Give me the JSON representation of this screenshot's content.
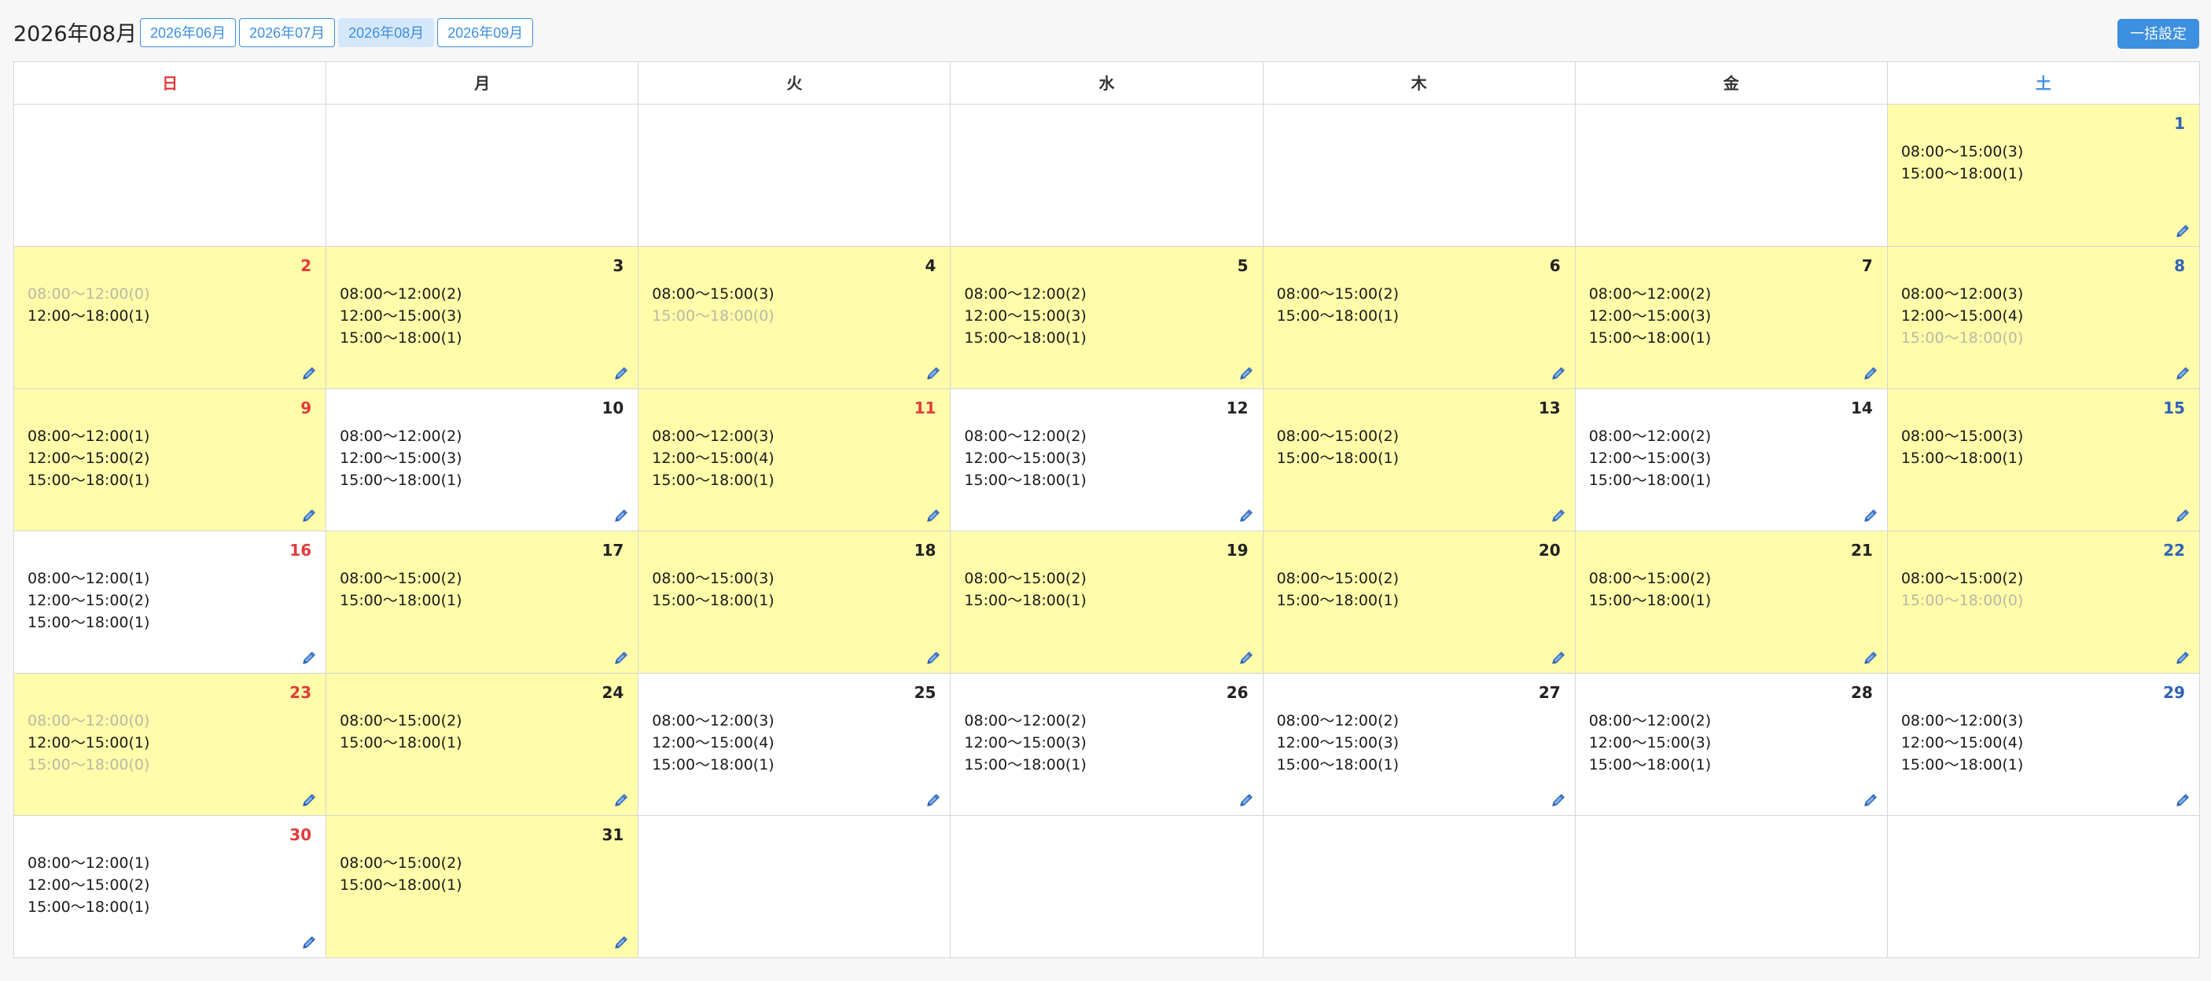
{
  "header": {
    "title": "2026年08月",
    "tabs": [
      {
        "label": "2026年06月",
        "active": false
      },
      {
        "label": "2026年07月",
        "active": false
      },
      {
        "label": "2026年08月",
        "active": true
      },
      {
        "label": "2026年09月",
        "active": false
      }
    ],
    "bulk_button_label": "一括設定"
  },
  "colors": {
    "accent": "#3d8fe0",
    "highlight": "#fffcaa",
    "sunday": "#e23b3b",
    "saturday": "#2f63b8",
    "inactive_text": "#b9b9a6"
  },
  "calendar": {
    "weekdays": [
      "日",
      "月",
      "火",
      "水",
      "木",
      "金",
      "土"
    ],
    "weeks": [
      [
        null,
        null,
        null,
        null,
        null,
        null,
        {
          "day": "1",
          "highlight": true,
          "slots": [
            {
              "text": "08:00〜15:00(3)",
              "active": true
            },
            {
              "text": "15:00〜18:00(1)",
              "active": true
            }
          ]
        }
      ],
      [
        {
          "day": "2",
          "highlight": true,
          "slots": [
            {
              "text": "08:00〜12:00(0)",
              "active": false
            },
            {
              "text": "12:00〜18:00(1)",
              "active": true
            }
          ]
        },
        {
          "day": "3",
          "highlight": true,
          "slots": [
            {
              "text": "08:00〜12:00(2)",
              "active": true
            },
            {
              "text": "12:00〜15:00(3)",
              "active": true
            },
            {
              "text": "15:00〜18:00(1)",
              "active": true
            }
          ]
        },
        {
          "day": "4",
          "highlight": true,
          "slots": [
            {
              "text": "08:00〜15:00(3)",
              "active": true
            },
            {
              "text": "15:00〜18:00(0)",
              "active": false
            }
          ]
        },
        {
          "day": "5",
          "highlight": true,
          "slots": [
            {
              "text": "08:00〜12:00(2)",
              "active": true
            },
            {
              "text": "12:00〜15:00(3)",
              "active": true
            },
            {
              "text": "15:00〜18:00(1)",
              "active": true
            }
          ]
        },
        {
          "day": "6",
          "highlight": true,
          "slots": [
            {
              "text": "08:00〜15:00(2)",
              "active": true
            },
            {
              "text": "15:00〜18:00(1)",
              "active": true
            }
          ]
        },
        {
          "day": "7",
          "highlight": true,
          "slots": [
            {
              "text": "08:00〜12:00(2)",
              "active": true
            },
            {
              "text": "12:00〜15:00(3)",
              "active": true
            },
            {
              "text": "15:00〜18:00(1)",
              "active": true
            }
          ]
        },
        {
          "day": "8",
          "highlight": true,
          "slots": [
            {
              "text": "08:00〜12:00(3)",
              "active": true
            },
            {
              "text": "12:00〜15:00(4)",
              "active": true
            },
            {
              "text": "15:00〜18:00(0)",
              "active": false
            }
          ]
        }
      ],
      [
        {
          "day": "9",
          "highlight": true,
          "slots": [
            {
              "text": "08:00〜12:00(1)",
              "active": true
            },
            {
              "text": "12:00〜15:00(2)",
              "active": true
            },
            {
              "text": "15:00〜18:00(1)",
              "active": true
            }
          ]
        },
        {
          "day": "10",
          "highlight": false,
          "slots": [
            {
              "text": "08:00〜12:00(2)",
              "active": true
            },
            {
              "text": "12:00〜15:00(3)",
              "active": true
            },
            {
              "text": "15:00〜18:00(1)",
              "active": true
            }
          ]
        },
        {
          "day": "11",
          "highlight": true,
          "holiday": true,
          "slots": [
            {
              "text": "08:00〜12:00(3)",
              "active": true
            },
            {
              "text": "12:00〜15:00(4)",
              "active": true
            },
            {
              "text": "15:00〜18:00(1)",
              "active": true
            }
          ]
        },
        {
          "day": "12",
          "highlight": false,
          "slots": [
            {
              "text": "08:00〜12:00(2)",
              "active": true
            },
            {
              "text": "12:00〜15:00(3)",
              "active": true
            },
            {
              "text": "15:00〜18:00(1)",
              "active": true
            }
          ]
        },
        {
          "day": "13",
          "highlight": true,
          "slots": [
            {
              "text": "08:00〜15:00(2)",
              "active": true
            },
            {
              "text": "15:00〜18:00(1)",
              "active": true
            }
          ]
        },
        {
          "day": "14",
          "highlight": false,
          "slots": [
            {
              "text": "08:00〜12:00(2)",
              "active": true
            },
            {
              "text": "12:00〜15:00(3)",
              "active": true
            },
            {
              "text": "15:00〜18:00(1)",
              "active": true
            }
          ]
        },
        {
          "day": "15",
          "highlight": true,
          "slots": [
            {
              "text": "08:00〜15:00(3)",
              "active": true
            },
            {
              "text": "15:00〜18:00(1)",
              "active": true
            }
          ]
        }
      ],
      [
        {
          "day": "16",
          "highlight": false,
          "slots": [
            {
              "text": "08:00〜12:00(1)",
              "active": true
            },
            {
              "text": "12:00〜15:00(2)",
              "active": true
            },
            {
              "text": "15:00〜18:00(1)",
              "active": true
            }
          ]
        },
        {
          "day": "17",
          "highlight": true,
          "slots": [
            {
              "text": "08:00〜15:00(2)",
              "active": true
            },
            {
              "text": "15:00〜18:00(1)",
              "active": true
            }
          ]
        },
        {
          "day": "18",
          "highlight": true,
          "slots": [
            {
              "text": "08:00〜15:00(3)",
              "active": true
            },
            {
              "text": "15:00〜18:00(1)",
              "active": true
            }
          ]
        },
        {
          "day": "19",
          "highlight": true,
          "slots": [
            {
              "text": "08:00〜15:00(2)",
              "active": true
            },
            {
              "text": "15:00〜18:00(1)",
              "active": true
            }
          ]
        },
        {
          "day": "20",
          "highlight": true,
          "slots": [
            {
              "text": "08:00〜15:00(2)",
              "active": true
            },
            {
              "text": "15:00〜18:00(1)",
              "active": true
            }
          ]
        },
        {
          "day": "21",
          "highlight": true,
          "slots": [
            {
              "text": "08:00〜15:00(2)",
              "active": true
            },
            {
              "text": "15:00〜18:00(1)",
              "active": true
            }
          ]
        },
        {
          "day": "22",
          "highlight": true,
          "slots": [
            {
              "text": "08:00〜15:00(2)",
              "active": true
            },
            {
              "text": "15:00〜18:00(0)",
              "active": false
            }
          ]
        }
      ],
      [
        {
          "day": "23",
          "highlight": true,
          "slots": [
            {
              "text": "08:00〜12:00(0)",
              "active": false
            },
            {
              "text": "12:00〜15:00(1)",
              "active": true
            },
            {
              "text": "15:00〜18:00(0)",
              "active": false
            }
          ]
        },
        {
          "day": "24",
          "highlight": true,
          "slots": [
            {
              "text": "08:00〜15:00(2)",
              "active": true
            },
            {
              "text": "15:00〜18:00(1)",
              "active": true
            }
          ]
        },
        {
          "day": "25",
          "highlight": false,
          "slots": [
            {
              "text": "08:00〜12:00(3)",
              "active": true
            },
            {
              "text": "12:00〜15:00(4)",
              "active": true
            },
            {
              "text": "15:00〜18:00(1)",
              "active": true
            }
          ]
        },
        {
          "day": "26",
          "highlight": false,
          "slots": [
            {
              "text": "08:00〜12:00(2)",
              "active": true
            },
            {
              "text": "12:00〜15:00(3)",
              "active": true
            },
            {
              "text": "15:00〜18:00(1)",
              "active": true
            }
          ]
        },
        {
          "day": "27",
          "highlight": false,
          "slots": [
            {
              "text": "08:00〜12:00(2)",
              "active": true
            },
            {
              "text": "12:00〜15:00(3)",
              "active": true
            },
            {
              "text": "15:00〜18:00(1)",
              "active": true
            }
          ]
        },
        {
          "day": "28",
          "highlight": false,
          "slots": [
            {
              "text": "08:00〜12:00(2)",
              "active": true
            },
            {
              "text": "12:00〜15:00(3)",
              "active": true
            },
            {
              "text": "15:00〜18:00(1)",
              "active": true
            }
          ]
        },
        {
          "day": "29",
          "highlight": false,
          "slots": [
            {
              "text": "08:00〜12:00(3)",
              "active": true
            },
            {
              "text": "12:00〜15:00(4)",
              "active": true
            },
            {
              "text": "15:00〜18:00(1)",
              "active": true
            }
          ]
        }
      ],
      [
        {
          "day": "30",
          "highlight": false,
          "slots": [
            {
              "text": "08:00〜12:00(1)",
              "active": true
            },
            {
              "text": "12:00〜15:00(2)",
              "active": true
            },
            {
              "text": "15:00〜18:00(1)",
              "active": true
            }
          ]
        },
        {
          "day": "31",
          "highlight": true,
          "slots": [
            {
              "text": "08:00〜15:00(2)",
              "active": true
            },
            {
              "text": "15:00〜18:00(1)",
              "active": true
            }
          ]
        },
        null,
        null,
        null,
        null,
        null
      ]
    ]
  }
}
